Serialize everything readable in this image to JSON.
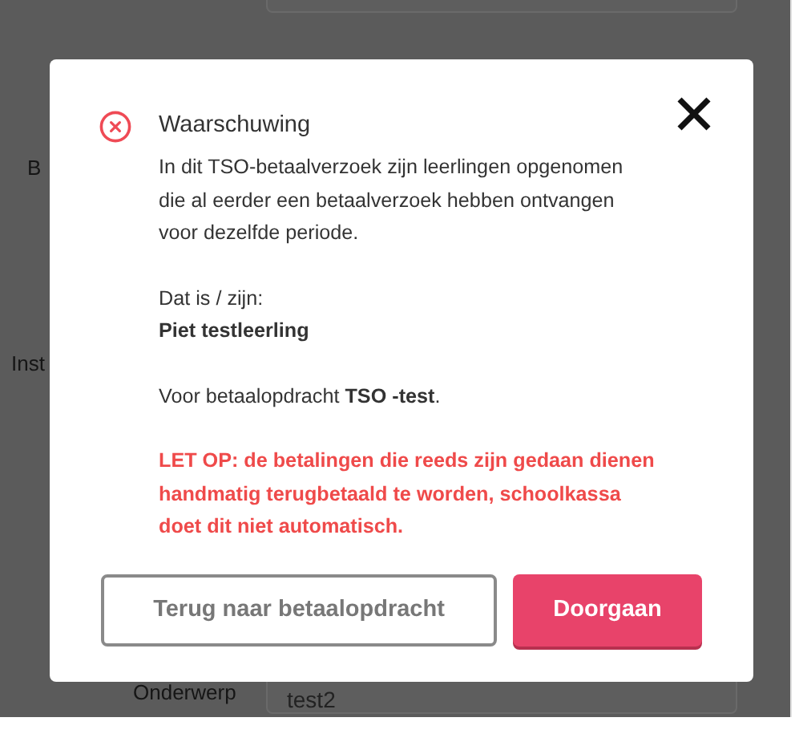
{
  "background_form": {
    "labels": [
      "B",
      "Inst",
      "Onderwerp"
    ],
    "subject_value": "test2"
  },
  "dialog": {
    "title": "Waarschuwing",
    "message": "In dit TSO-betaalverzoek zijn leerlingen opgenomen die al eerder een betaalverzoek hebben ontvangen voor dezelfde periode.",
    "students_label": "Dat is / zijn:",
    "students": [
      "Piet testleerling"
    ],
    "assignment": "Voor betaalopdracht **TSO -test**.",
    "warning": "LET OP: de betalingen die reeds zijn gedaan dienen handmatig terugbetaald te worden, schoolkassa doet dit niet automatisch.",
    "buttons": [
      {
        "label": "Terug naar betaalopdracht",
        "kind": "secondary"
      },
      {
        "label": "Doorgaan",
        "kind": "primary"
      }
    ]
  }
}
